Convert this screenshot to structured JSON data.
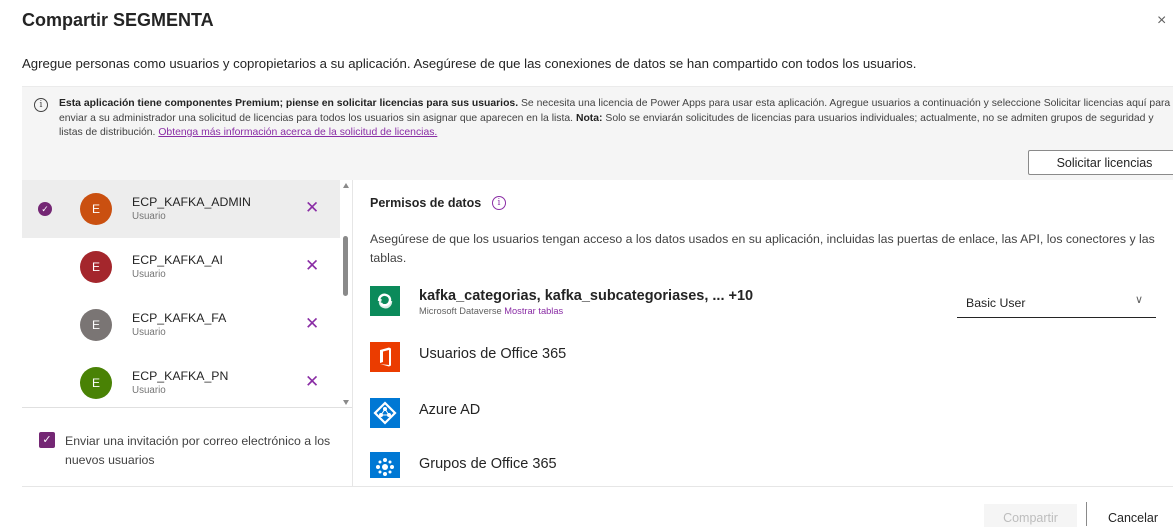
{
  "dialog": {
    "title": "Compartir SEGMENTA",
    "close_icon": "×",
    "subtitle": "Agregue personas como usuarios y copropietarios a su aplicación. Asegúrese de que las conexiones de datos se han compartido con todos los usuarios."
  },
  "notice": {
    "icon": "i",
    "bold_lead": "Esta aplicación tiene componentes Premium; piense en solicitar licencias para sus usuarios.",
    "text_1": " Se necesita una licencia de Power Apps para usar esta aplicación. Agregue usuarios a continuación y seleccione Solicitar licencias aquí para enviar a su administrador una solicitud de licencias para todos los usuarios sin asignar que aparecen en la lista. ",
    "bold_note": "Nota:",
    "text_2": " Solo se enviarán solicitudes de licencias para usuarios individuales; actualmente, no se admiten grupos de seguridad y listas de distribución. ",
    "link": "Obtenga más información acerca de la solicitud de licencias.",
    "button_label": "Solicitar licencias"
  },
  "users": [
    {
      "initial": "E",
      "name": "ECP_KAFKA_ADMIN",
      "role": "Usuario",
      "avatar_color": "#ca5010",
      "selected": true
    },
    {
      "initial": "E",
      "name": "ECP_KAFKA_AI",
      "role": "Usuario",
      "avatar_color": "#a4262c",
      "selected": false
    },
    {
      "initial": "E",
      "name": "ECP_KAFKA_FA",
      "role": "Usuario",
      "avatar_color": "#7a7574",
      "selected": false
    },
    {
      "initial": "E",
      "name": "ECP_KAFKA_PN",
      "role": "Usuario",
      "avatar_color": "#498205",
      "selected": false
    }
  ],
  "invite": {
    "label": "Enviar una invitación por correo electrónico a los nuevos usuarios",
    "checked": true
  },
  "permissions": {
    "title": "Permisos de datos",
    "info_icon": "i",
    "description": "Asegúrese de que los usuarios tengan acceso a los datos usados en su aplicación, incluidas las puertas de enlace, las API, los conectores y las tablas.",
    "sources": [
      {
        "name": "kafka_categorias, kafka_subcategoriases, ... +10",
        "subtitle": "Microsoft Dataverse",
        "link": "Mostrar tablas",
        "icon": "dataverse-icon",
        "role": "Basic User"
      },
      {
        "name": "Usuarios de Office 365",
        "icon": "office365-icon"
      },
      {
        "name": "Azure AD",
        "icon": "azure-ad-icon"
      },
      {
        "name": "Grupos de Office 365",
        "icon": "office365-groups-icon"
      }
    ],
    "role_chevron": "∨"
  },
  "footer": {
    "share_label": "Compartir",
    "cancel_label": "Cancelar"
  },
  "colors": {
    "accent": "#742774",
    "link": "#8a2da5",
    "dataverse": "#0b8a5a",
    "office": "#eb3c00",
    "azure": "#0078d4"
  }
}
